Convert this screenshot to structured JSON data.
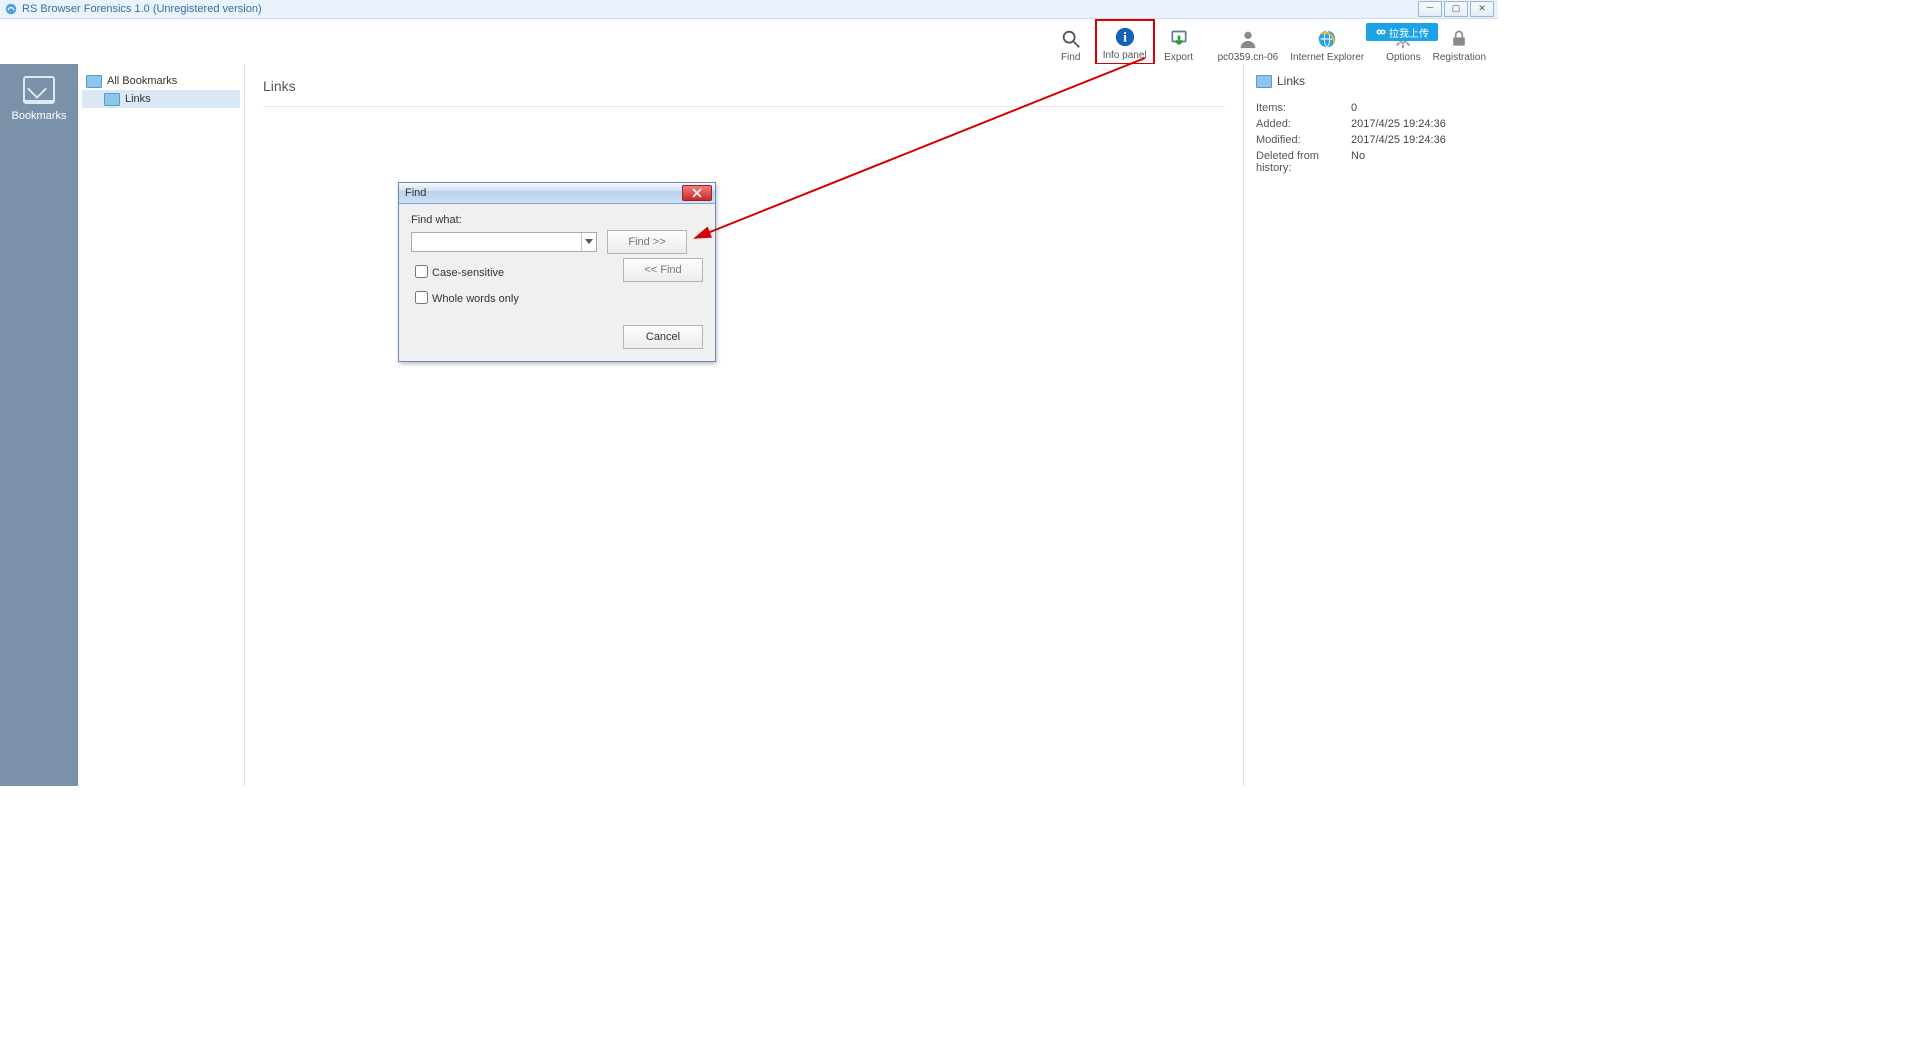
{
  "window": {
    "title": "RS Browser Forensics 1.0 (Unregistered version)"
  },
  "toolbar": {
    "find": "Find",
    "info_panel": "Info panel",
    "export": "Export",
    "user": "pc0359.cn-06",
    "browser": "Internet Explorer",
    "options": "Options",
    "registration": "Registration",
    "upload_badge": "拉我上传"
  },
  "nav": {
    "bookmarks": "Bookmarks"
  },
  "tree": {
    "root": "All Bookmarks",
    "child": "Links"
  },
  "content": {
    "heading": "Links"
  },
  "info": {
    "title": "Links",
    "rows": [
      {
        "k": "Items:",
        "v": "0"
      },
      {
        "k": "Added:",
        "v": "2017/4/25 19:24:36"
      },
      {
        "k": "Modified:",
        "v": "2017/4/25 19:24:36"
      },
      {
        "k": "Deleted from history:",
        "v": "No"
      }
    ]
  },
  "dialog": {
    "title": "Find",
    "find_what": "Find what:",
    "value": "",
    "btn_next": "Find >>",
    "btn_prev": "<< Find",
    "case": "Case-sensitive",
    "whole": "Whole words only",
    "cancel": "Cancel"
  }
}
